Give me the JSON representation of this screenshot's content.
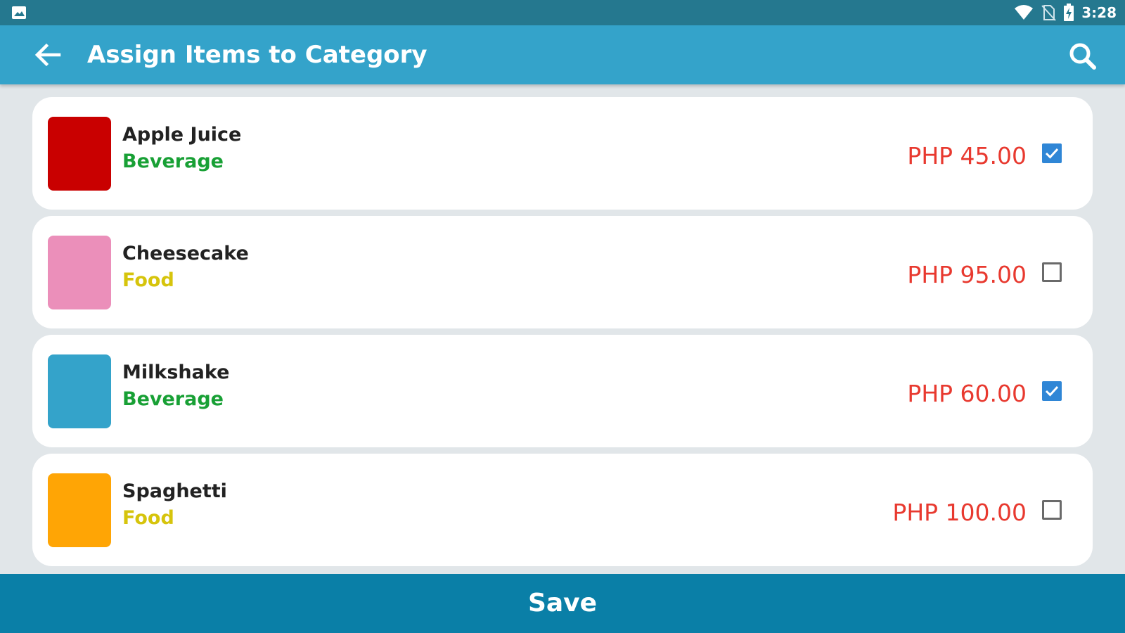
{
  "status_bar": {
    "time": "3:28",
    "icons": [
      "gallery-icon",
      "wifi-icon",
      "no-sim-icon",
      "battery-charging-icon"
    ]
  },
  "app_bar": {
    "title": "Assign Items to Category",
    "back_icon": "arrow-back-icon",
    "search_icon": "search-icon"
  },
  "colors": {
    "status_bar": "#25788f",
    "app_bar": "#34a3ca",
    "save_bar": "#0a7fa7",
    "price": "#e8392f",
    "checkbox_checked": "#2f86d6",
    "background": "#e1e6e9"
  },
  "items": [
    {
      "name": "Apple Juice",
      "category": "Beverage",
      "category_color": "#18a035",
      "swatch_color": "#c90000",
      "price": "PHP 45.00",
      "checked": true
    },
    {
      "name": "Cheesecake",
      "category": "Food",
      "category_color": "#d6c40c",
      "swatch_color": "#eb8fba",
      "price": "PHP 95.00",
      "checked": false
    },
    {
      "name": "Milkshake",
      "category": "Beverage",
      "category_color": "#18a035",
      "swatch_color": "#34a3ca",
      "price": "PHP 60.00",
      "checked": true
    },
    {
      "name": "Spaghetti",
      "category": "Food",
      "category_color": "#d6c40c",
      "swatch_color": "#ffa505",
      "price": "PHP 100.00",
      "checked": false
    }
  ],
  "save_button": {
    "label": "Save"
  }
}
